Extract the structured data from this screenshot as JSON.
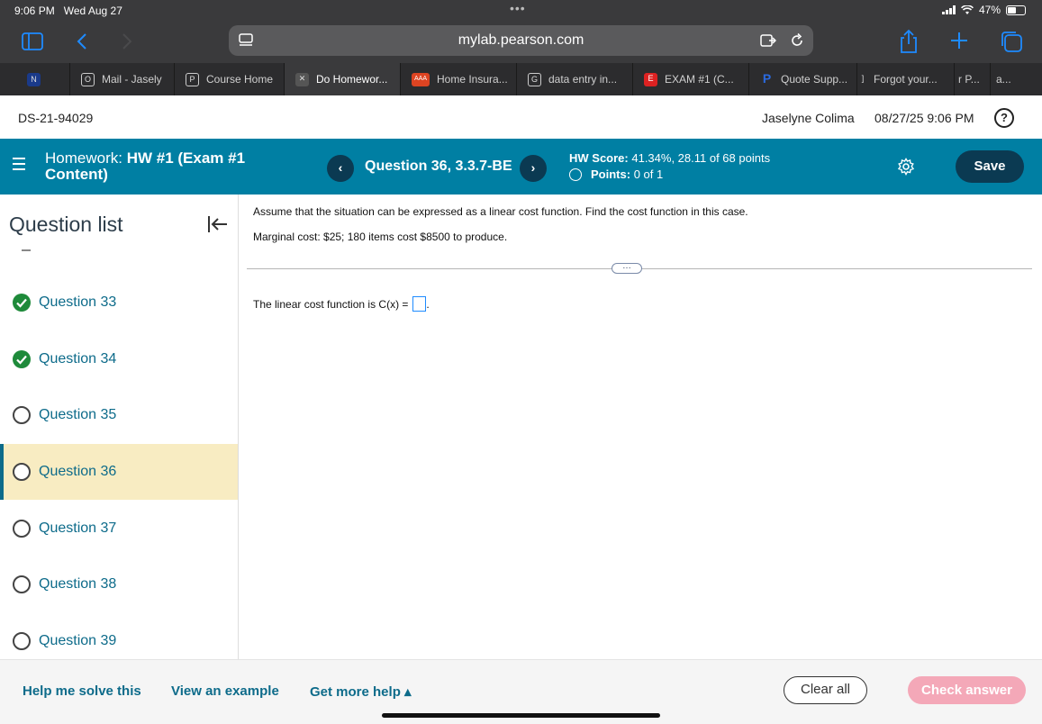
{
  "status_bar": {
    "time": "9:06 PM",
    "date": "Wed Aug 27",
    "battery": "47%"
  },
  "browser": {
    "url": "mylab.pearson.com",
    "tabs": [
      {
        "label": "N",
        "icon": "n-favicon",
        "active": false
      },
      {
        "label": "Mail - Jasely",
        "icon": "o-favicon",
        "active": false
      },
      {
        "label": "Course Home",
        "icon": "p-favicon",
        "active": false
      },
      {
        "label": "Do Homewor...",
        "icon": "x-favicon",
        "active": true
      },
      {
        "label": "Home Insura...",
        "icon": "aaa-favicon",
        "active": false
      },
      {
        "label": "data entry in...",
        "icon": "g-favicon",
        "active": false
      },
      {
        "label": "EXAM #1 (C...",
        "icon": "exam-favicon",
        "active": false
      },
      {
        "label": "Quote Supp...",
        "icon": "paypal-favicon",
        "active": false
      },
      {
        "label": "Forgot your...",
        "icon": "bracket-favicon",
        "active": false
      },
      {
        "label": "r P...",
        "icon": "",
        "active": false
      },
      {
        "label": "a...",
        "icon": "",
        "active": false
      }
    ]
  },
  "header": {
    "course_code": "DS-21-94029",
    "user_name": "Jaselyne Colima",
    "datetime": "08/27/25 9:06 PM"
  },
  "homework": {
    "title_prefix": "Homework:",
    "title_bold": "HW #1 (Exam #1",
    "title_line2": "Content)",
    "question_label": "Question 36, 3.3.7-BE",
    "score_label": "HW Score:",
    "score_value": "41.34%, 28.11 of 68 points",
    "points_label": "Points:",
    "points_value": "0 of 1",
    "save_label": "Save"
  },
  "sidebar": {
    "title": "Question list",
    "items": [
      {
        "label": "Question 33",
        "status": "done"
      },
      {
        "label": "Question 34",
        "status": "done"
      },
      {
        "label": "Question 35",
        "status": "open"
      },
      {
        "label": "Question 36",
        "status": "current"
      },
      {
        "label": "Question 37",
        "status": "open"
      },
      {
        "label": "Question 38",
        "status": "open"
      },
      {
        "label": "Question 39",
        "status": "open"
      }
    ]
  },
  "question": {
    "instruction": "Assume that the situation can be expressed as a linear cost function. Find the cost function in this case.",
    "given": "Marginal cost: $25; 180 items cost $8500 to produce.",
    "more_label": "…",
    "answer_prefix": "The linear cost function is C(x) =",
    "answer_suffix": ".",
    "answer_value": ""
  },
  "footer": {
    "help_solve": "Help me solve this",
    "view_example": "View an example",
    "more_help": "Get more help ▴",
    "clear_all": "Clear all",
    "check_answer": "Check answer"
  },
  "colors": {
    "brand_teal": "#007fa3",
    "dark_navy": "#0b3a52",
    "done_green": "#1e8a3a",
    "current_highlight": "#f8ecc2",
    "check_disabled": "#f4a8b8"
  }
}
